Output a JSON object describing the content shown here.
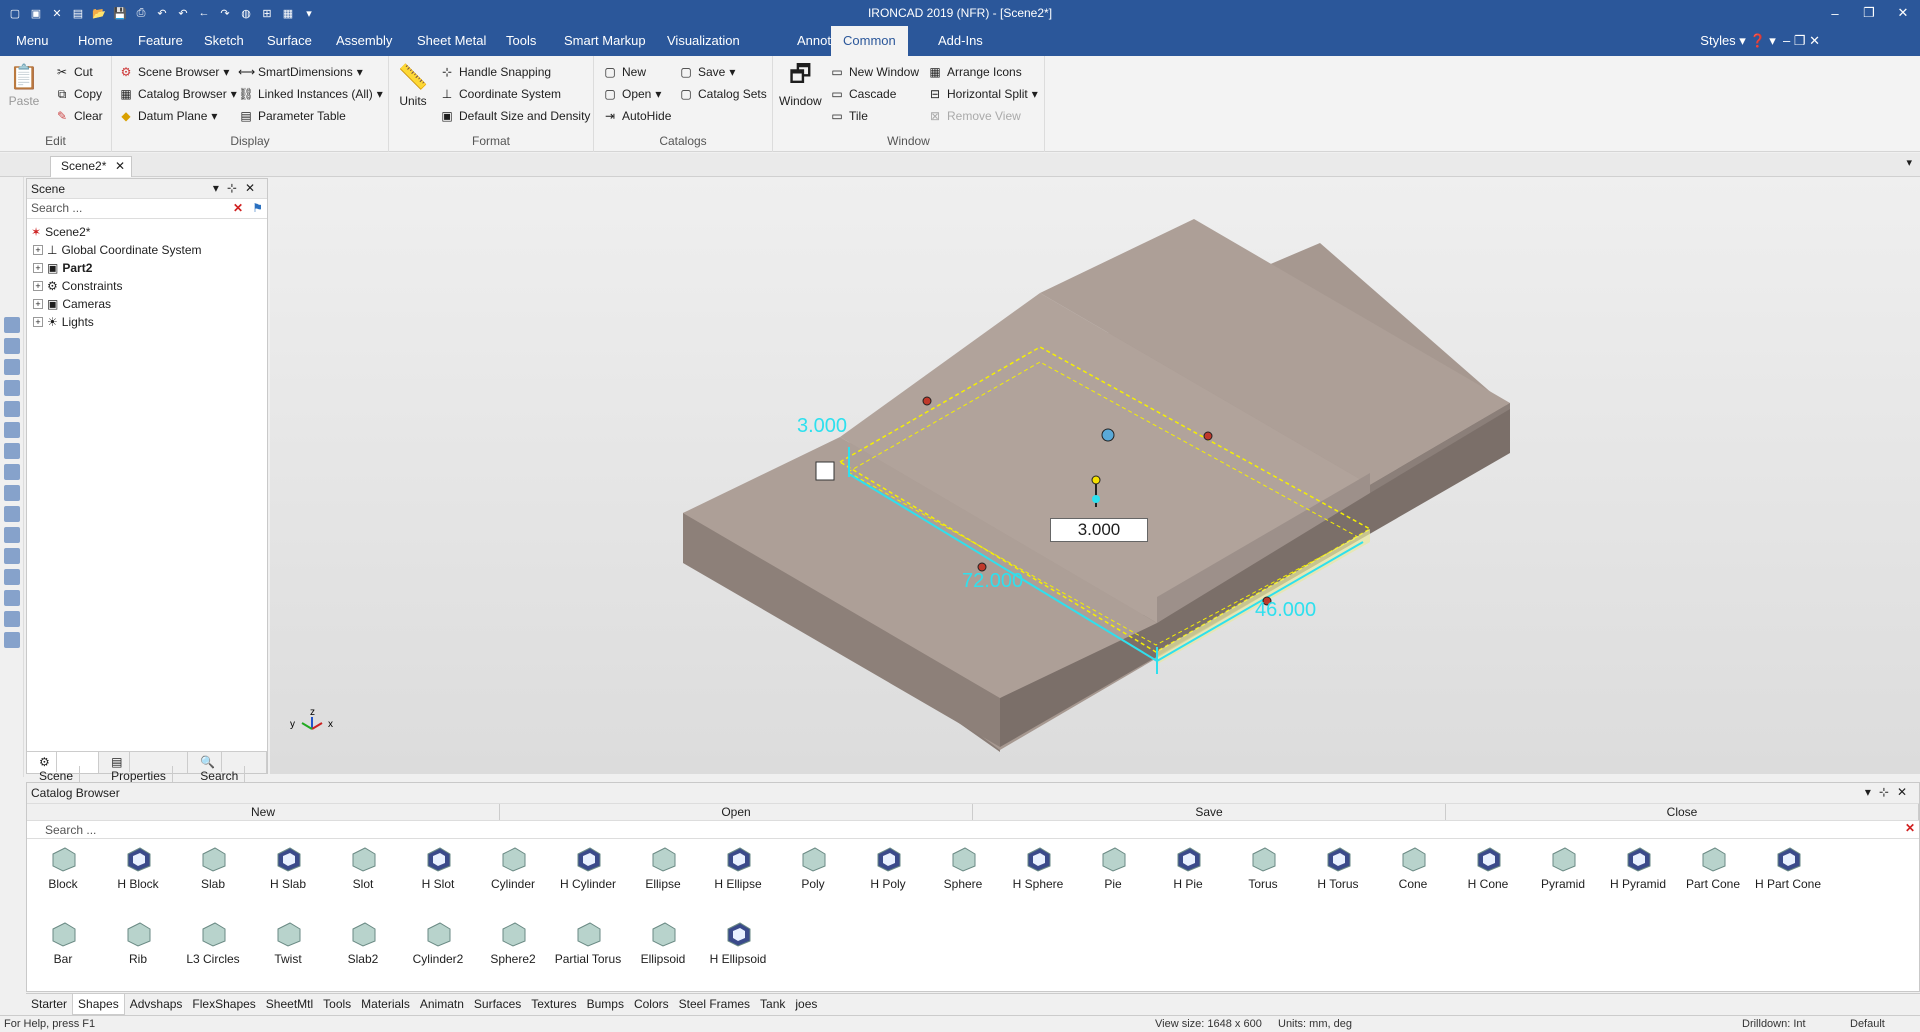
{
  "window": {
    "title": "IRONCAD 2019 (NFR) - [Scene2*]"
  },
  "qat_icons": [
    "new-icon",
    "close-doc-icon",
    "close-icon",
    "pdf-icon",
    "open-icon",
    "save-icon",
    "print-icon",
    "undo-list-icon",
    "undo-icon",
    "back-icon",
    "redo-icon",
    "web-icon",
    "tree-icon",
    "grid-icon",
    "dropdown-icon"
  ],
  "menu": {
    "tabs": [
      "Menu",
      "Home",
      "Feature",
      "Sketch",
      "Surface",
      "Assembly",
      "Sheet Metal",
      "Tools",
      "Smart Markup",
      "Visualization",
      "Annotation",
      "Common",
      "Add-Ins"
    ],
    "active": "Common",
    "styles": "Styles"
  },
  "ribbon": {
    "edit": {
      "label": "Edit",
      "paste": "Paste",
      "cut": "Cut",
      "copy": "Copy",
      "clear": "Clear"
    },
    "display": {
      "label": "Display",
      "scene_browser": "Scene Browser",
      "catalog_browser": "Catalog Browser",
      "datum_plane": "Datum Plane",
      "smart_dimensions": "SmartDimensions",
      "linked_instances": "Linked Instances (All)",
      "parameter_table": "Parameter Table"
    },
    "format": {
      "label": "Format",
      "units": "Units",
      "handle_snapping": "Handle Snapping",
      "coordinate_system": "Coordinate System",
      "default_size": "Default Size and Density"
    },
    "catalogs": {
      "label": "Catalogs",
      "new": "New",
      "open": "Open",
      "autohide": "AutoHide",
      "save": "Save",
      "catalog_sets": "Catalog Sets"
    },
    "window": {
      "label": "Window",
      "window": "Window",
      "new_window": "New Window",
      "cascade": "Cascade",
      "tile": "Tile",
      "arrange_icons": "Arrange Icons",
      "horizontal_split": "Horizontal Split",
      "remove_view": "Remove View"
    }
  },
  "doc_tab": "Scene2*",
  "scene_panel": {
    "title": "Scene",
    "search_placeholder": "Search ...",
    "root": "Scene2*",
    "items": [
      "Global Coordinate System",
      "Part2",
      "Constraints",
      "Cameras",
      "Lights"
    ],
    "tabs": [
      "Scene",
      "Properties",
      "Search"
    ]
  },
  "viewport": {
    "dims": {
      "d1": "3.000",
      "d2": "72.000",
      "d3": "46.000",
      "input": "3.000"
    },
    "axis": {
      "x": "x",
      "y": "y",
      "z": "z"
    }
  },
  "catalog": {
    "title": "Catalog Browser",
    "buttons": [
      "New",
      "Open",
      "Save",
      "Close"
    ],
    "search_placeholder": "Search ...",
    "shapes_row1": [
      "Block",
      "H Block",
      "Slab",
      "H Slab",
      "Slot",
      "H Slot",
      "Cylinder",
      "H Cylinder",
      "Ellipse",
      "H Ellipse",
      "Poly",
      "H Poly",
      "Sphere",
      "H Sphere",
      "Pie",
      "H Pie",
      "Torus",
      "H Torus",
      "Cone",
      "H Cone",
      "Pyramid",
      "H Pyramid",
      "Part Cone",
      "H Part Cone"
    ],
    "shapes_row2": [
      "Bar",
      "Rib",
      "L3 Circles",
      "Twist",
      "Slab2",
      "Cylinder2",
      "Sphere2",
      "Partial Torus",
      "Ellipsoid",
      "H Ellipsoid"
    ],
    "tabs": [
      "Starter",
      "Shapes",
      "Advshaps",
      "FlexShapes",
      "SheetMtl",
      "Tools",
      "Materials",
      "Animatn",
      "Surfaces",
      "Textures",
      "Bumps",
      "Colors",
      "Steel Frames",
      "Tank",
      "joes"
    ],
    "active_tab": "Shapes"
  },
  "status": {
    "help": "For Help, press F1",
    "view_size": "View size: 1648 x 600",
    "units": "Units: mm, deg",
    "drilldown": "Drilldown: Int",
    "default": "Default"
  }
}
